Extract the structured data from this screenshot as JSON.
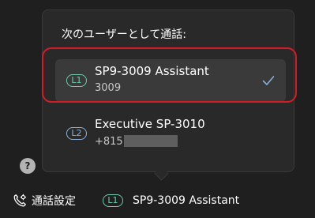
{
  "popup": {
    "title": "次のユーザーとして通話:",
    "options": [
      {
        "badge": "L1",
        "name": "SP9-3009 Assistant",
        "number": "3009",
        "selected": true
      },
      {
        "badge": "L2",
        "name": "Executive SP-3010",
        "number": "+815",
        "number_redacted": true,
        "selected": false
      }
    ],
    "selected_icon": "checkmark-icon"
  },
  "help": {
    "label": "?",
    "icon": "help-icon"
  },
  "footer": {
    "call_settings_label": "通話設定",
    "call_settings_icon": "phone-settings-icon",
    "current_line_badge": "L1",
    "current_line_name": "SP9-3009 Assistant"
  },
  "colors": {
    "background": "#1f1f1f",
    "popup": "#292929",
    "selected_row": "#3a3a3a",
    "highlight": "#d41c29",
    "badge_l1": "#6fc7ac",
    "badge_l2": "#8ab0d6",
    "checkmark": "#8ab0d6"
  }
}
